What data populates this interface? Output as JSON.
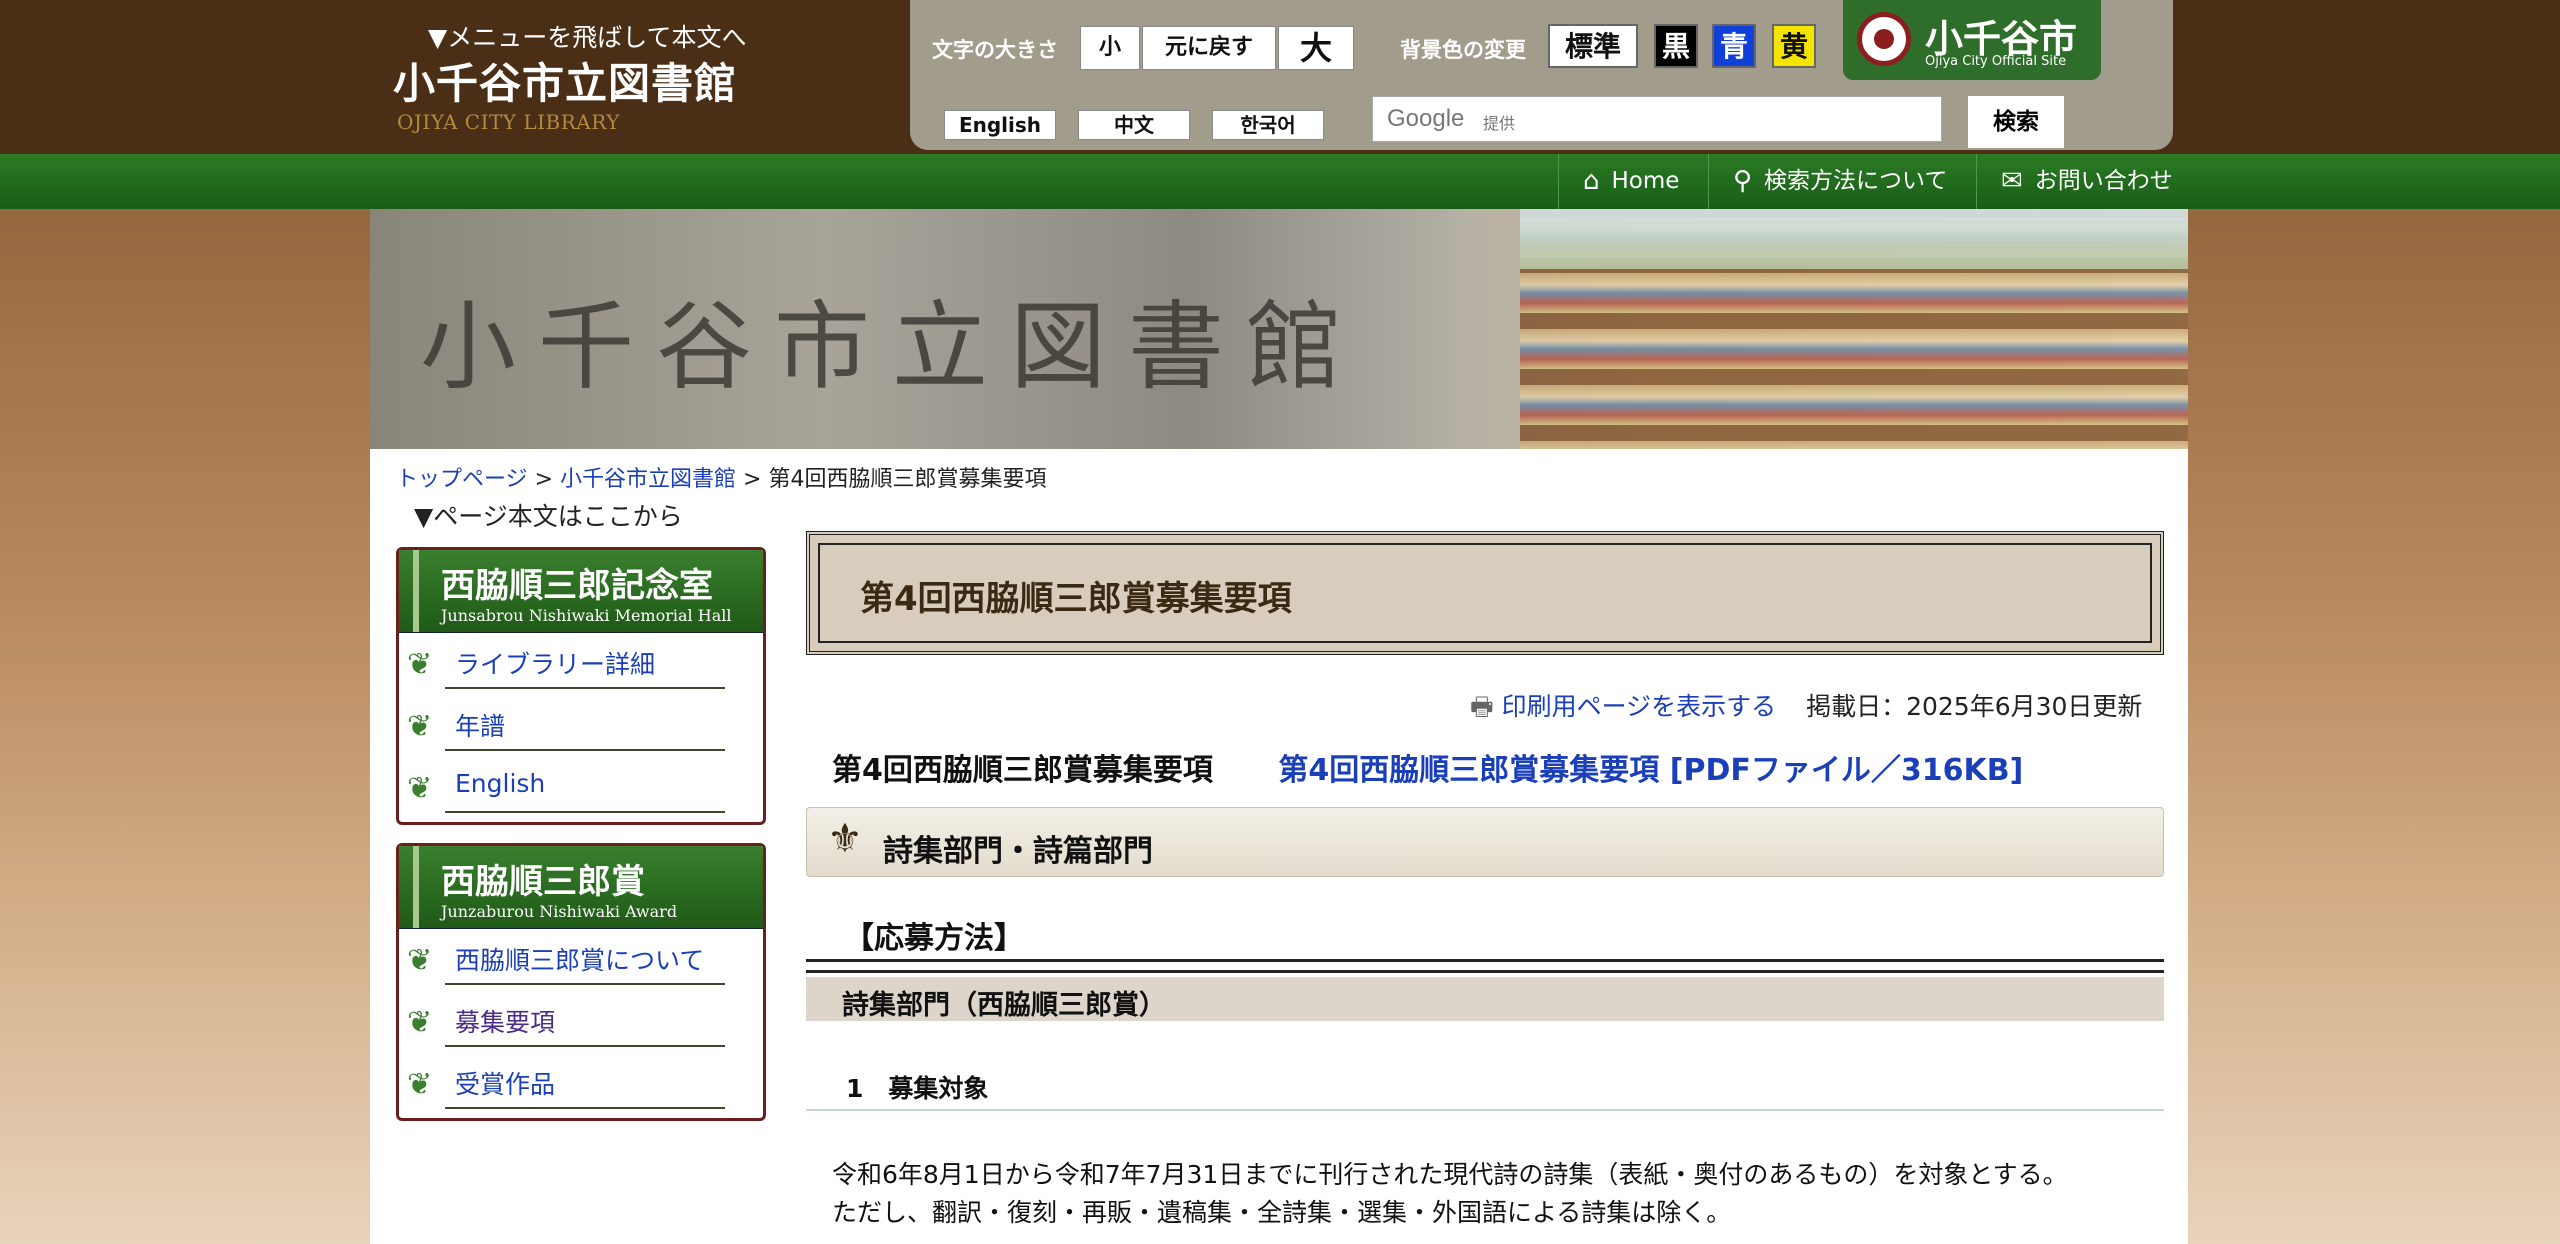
{
  "header": {
    "skip_link": "▼メニューを飛ばして本文へ",
    "site_title": "小千谷市立図書館",
    "site_subtitle": "OJIYA CITY LIBRARY",
    "text_size_label": "文字の大きさ",
    "size_small": "小",
    "size_reset": "元に戻す",
    "size_large": "大",
    "bg_color_label": "背景色の変更",
    "color_standard": "標準",
    "color_black": "黒",
    "color_blue": "青",
    "color_yellow": "黄",
    "lang_english": "English",
    "lang_chinese": "中文",
    "lang_korean": "한국어",
    "search_google": "Google",
    "search_google_sub": "提供",
    "search_button": "検索",
    "city_name": "小千谷市",
    "city_sub": "Ojiya City Official Site"
  },
  "nav": {
    "home": "Home",
    "search_method": "検索方法について",
    "contact": "お問い合わせ"
  },
  "banner": {
    "text": "小千谷市立図書館"
  },
  "breadcrumb": {
    "top": "トップページ",
    "library": "小千谷市立図書館",
    "current": "第4回西脇順三郎賞募集要項",
    "sep": ">"
  },
  "skip_main": "▼ページ本文はここから",
  "sidebar": {
    "memorial": {
      "title": "西脇順三郎記念室",
      "subtitle": "Junsabrou Nishiwaki Memorial Hall",
      "items": [
        "ライブラリー詳細",
        "年譜",
        "English"
      ]
    },
    "award": {
      "title": "西脇順三郎賞",
      "subtitle": "Junzaburou Nishiwaki Award",
      "items": [
        "西脇順三郎賞について",
        "募集要項",
        "受賞作品"
      ]
    }
  },
  "main": {
    "page_title": "第4回西脇順三郎賞募集要項",
    "print_link": "印刷用ページを表示する",
    "posted": "掲載日：2025年6月30日更新",
    "subhead": "第4回西脇順三郎賞募集要項",
    "pdf_link": "第4回西脇順三郎賞募集要項 [PDFファイル／316KB]",
    "section_title": "詩集部門・詩篇部門",
    "apply_heading": "【応募方法】",
    "dept_title": "詩集部門（西脇順三郎賞）",
    "target_heading": "1　募集対象",
    "body_line1": "令和6年8月1日から令和7年7月31日までに刊行された現代詩の詩集（表紙・奥付のあるもの）を対象とする。",
    "body_line2": "ただし、翻訳・復刻・再販・遺稿集・全詩集・選集・外国語による詩集は除く。"
  }
}
